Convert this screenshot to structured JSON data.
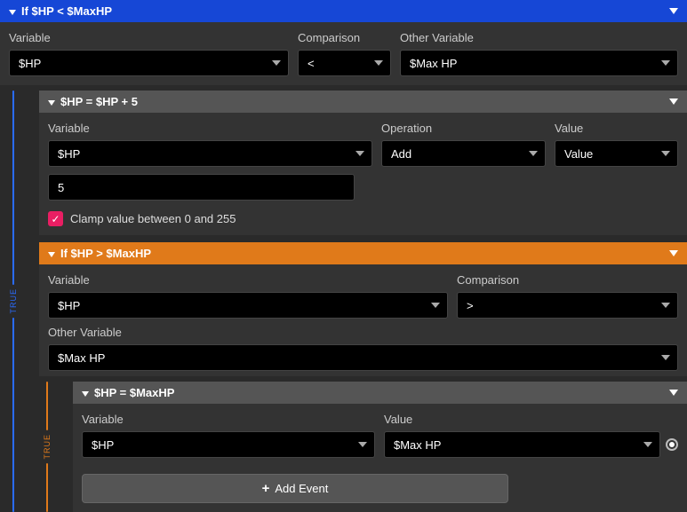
{
  "trueLabel": "TRUE",
  "outer": {
    "title": "If $HP < $MaxHP",
    "variableLabel": "Variable",
    "variableValue": "$HP",
    "comparisonLabel": "Comparison",
    "comparisonValue": "<",
    "otherVarLabel": "Other Variable",
    "otherVarValue": "$Max HP"
  },
  "assign1": {
    "title": "$HP = $HP + 5",
    "variableLabel": "Variable",
    "variableValue": "$HP",
    "operationLabel": "Operation",
    "operationValue": "Add",
    "valueLabel": "Value",
    "valueType": "Value",
    "value": "5",
    "clampLabel": "Clamp value between 0 and 255",
    "clampChecked": true
  },
  "innerIf": {
    "title": "If $HP > $MaxHP",
    "variableLabel": "Variable",
    "variableValue": "$HP",
    "comparisonLabel": "Comparison",
    "comparisonValue": ">",
    "otherVarLabel": "Other Variable",
    "otherVarValue": "$Max HP"
  },
  "assign2": {
    "title": "$HP = $MaxHP",
    "variableLabel": "Variable",
    "variableValue": "$HP",
    "valueLabel": "Value",
    "value": "$Max HP"
  },
  "addEventLabel": "Add Event"
}
